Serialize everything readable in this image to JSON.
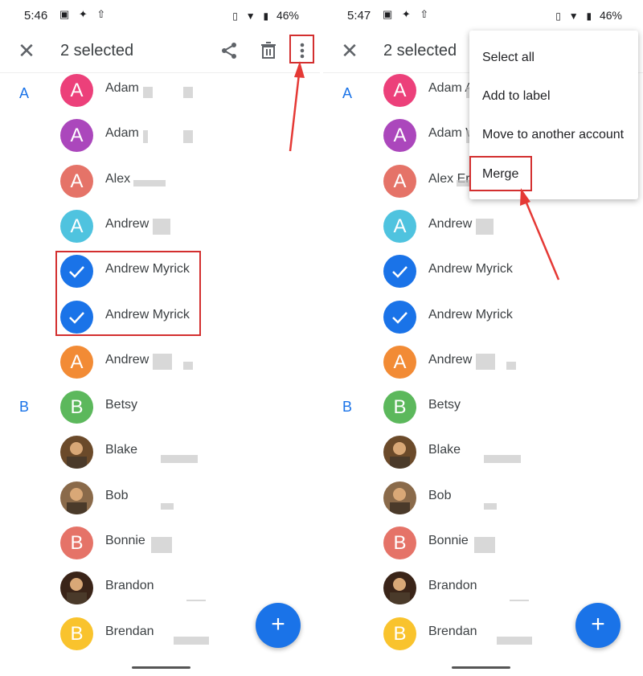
{
  "left": {
    "status": {
      "time": "5:46",
      "battery": "46%"
    },
    "toolbar": {
      "title": "2 selected"
    },
    "section_a": "A",
    "section_b": "B",
    "contacts": [
      {
        "name": "Adam",
        "initial": "A",
        "color": "#ec407a"
      },
      {
        "name": "Adam",
        "initial": "A",
        "color": "#ab47bc"
      },
      {
        "name": "Alex",
        "initial": "A",
        "color": "#e57368"
      },
      {
        "name": "Andrew",
        "initial": "A",
        "color": "#4fc3df"
      },
      {
        "name": "Andrew Myrick",
        "initial": "",
        "color": "#1a73e8",
        "selected": true
      },
      {
        "name": "Andrew Myrick",
        "initial": "",
        "color": "#1a73e8",
        "selected": true
      },
      {
        "name": "Andrew",
        "initial": "A",
        "color": "#f28b35"
      },
      {
        "name": "Betsy",
        "initial": "B",
        "color": "#5cb85c"
      },
      {
        "name": "Blake",
        "initial": "",
        "photo": true
      },
      {
        "name": "Bob",
        "initial": "",
        "photo": true
      },
      {
        "name": "Bonnie",
        "initial": "B",
        "color": "#e57368"
      },
      {
        "name": "Brandon",
        "initial": "",
        "photo": true
      },
      {
        "name": "Brendan",
        "initial": "B",
        "color": "#f9c32d"
      }
    ],
    "fab": "+"
  },
  "right": {
    "status": {
      "time": "5:47",
      "battery": "46%"
    },
    "toolbar": {
      "title": "2 selected"
    },
    "section_a": "A",
    "section_b": "B",
    "contacts": [
      {
        "name": "Adam A",
        "initial": "A"
      },
      {
        "name": "Adam W",
        "initial": "A"
      },
      {
        "name": "Alex Erv",
        "initial": "A"
      },
      {
        "name": "Andrew",
        "initial": "A"
      },
      {
        "name": "Andrew Myrick",
        "initial": ""
      },
      {
        "name": "Andrew Myrick",
        "initial": ""
      },
      {
        "name": "Andrew",
        "initial": "A"
      },
      {
        "name": "Betsy",
        "initial": "B"
      },
      {
        "name": "Blake",
        "initial": ""
      },
      {
        "name": "Bob",
        "initial": ""
      },
      {
        "name": "Bonnie",
        "initial": "B"
      },
      {
        "name": "Brandon",
        "initial": ""
      },
      {
        "name": "Brendan",
        "initial": "B"
      }
    ],
    "menu": {
      "select_all": "Select all",
      "add_to_label": "Add to label",
      "move": "Move to another account",
      "merge": "Merge"
    },
    "fab": "+"
  },
  "colors": {
    "accent": "#1a73e8",
    "highlight": "#d32f2f"
  }
}
